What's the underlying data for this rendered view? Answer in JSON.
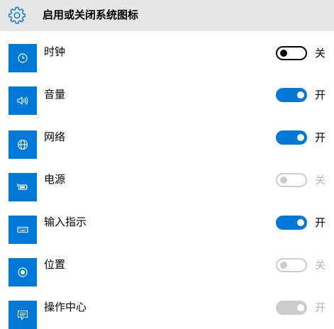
{
  "header": {
    "title": "启用或关闭系统图标",
    "icon": "gear-icon"
  },
  "colors": {
    "accent": "#0078d7",
    "header_bg": "#e6e6e6",
    "disabled": "#cccccc",
    "disabled_text": "#b8b8b8"
  },
  "items": [
    {
      "label": "时钟",
      "icon": "clock-icon",
      "state": "关",
      "on": false,
      "enabled": true
    },
    {
      "label": "音量",
      "icon": "volume-icon",
      "state": "开",
      "on": true,
      "enabled": true
    },
    {
      "label": "网络",
      "icon": "network-globe-icon",
      "state": "开",
      "on": true,
      "enabled": true
    },
    {
      "label": "电源",
      "icon": "battery-icon",
      "state": "关",
      "on": false,
      "enabled": false
    },
    {
      "label": "输入指示",
      "icon": "keyboard-icon",
      "state": "开",
      "on": true,
      "enabled": true
    },
    {
      "label": "位置",
      "icon": "location-icon",
      "state": "关",
      "on": false,
      "enabled": false
    },
    {
      "label": "操作中心",
      "icon": "action-center-icon",
      "state": "开",
      "on": true,
      "enabled": false
    }
  ]
}
